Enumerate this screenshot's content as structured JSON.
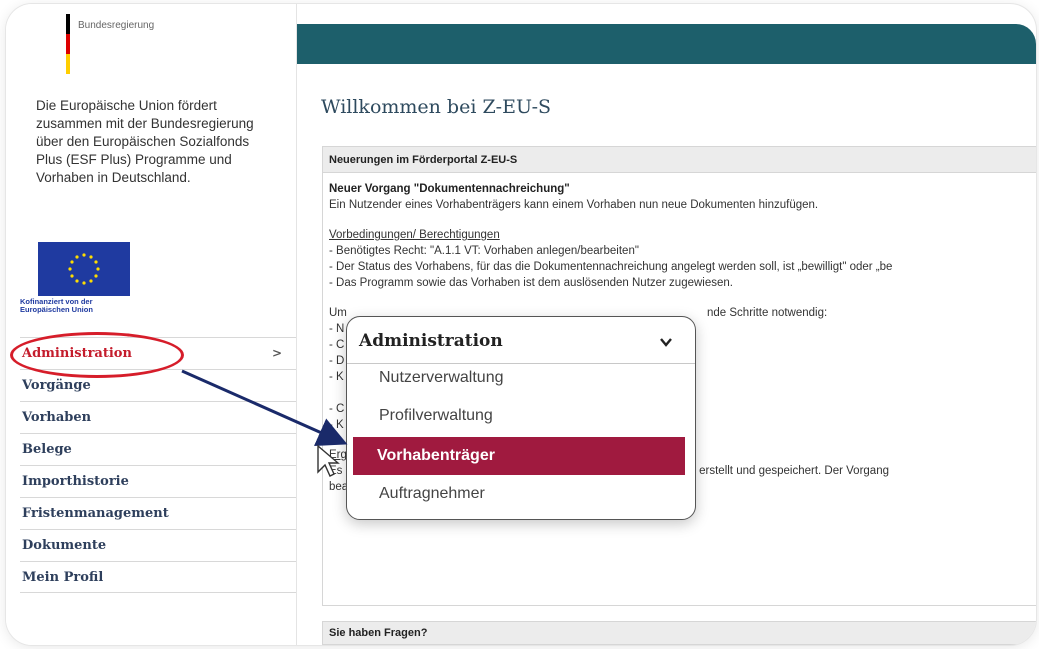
{
  "sidebar": {
    "brand": "Bundesregierung",
    "intro": "Die Europäische Union fördert zusammen mit der Bundesregierung über den Europäischen Sozialfonds Plus (ESF Plus) Programme und Vorhaben in Deutschland.",
    "eu_caption": "Kofinanziert von der Europäischen Union",
    "items": [
      {
        "label": "Administration"
      },
      {
        "label": "Vorgänge"
      },
      {
        "label": "Vorhaben"
      },
      {
        "label": "Belege"
      },
      {
        "label": "Importhistorie"
      },
      {
        "label": "Fristenmanagement"
      },
      {
        "label": "Dokumente"
      },
      {
        "label": "Mein Profil"
      }
    ],
    "active_chevron": ">"
  },
  "main": {
    "title": "Willkommen bei Z-EU-S",
    "news_header": "Neuerungen im Förderportal Z-EU-S",
    "news_title": "Neuer Vorgang \"Dokumentennachreichung\"",
    "news_text": "Ein Nutzender eines Vorhabenträgers kann einem Vorhaben nun neue Dokumenten hinzufügen.",
    "prereq_heading": "Vorbedingungen/ Berechtigungen",
    "prereq_lines": [
      "- Benötigtes Recht: \"A.1.1 VT: Vorhaben anlegen/bearbeiten\"",
      "- Der Status des Vorhabens, für das die Dokumentennachreichung angelegt werden soll, ist „bewilligt\" oder „be",
      "- Das Programm sowie das Vorhaben ist dem auslösenden Nutzer zugewiesen."
    ],
    "steps_intro_prefix": "Um",
    "steps_intro_suffix": "nde Schritte notwendig:",
    "hidden_line_prefixes": [
      "- N",
      "- C",
      "- D",
      "- K",
      "",
      "- C",
      "- K"
    ],
    "result_heading": "Ergebnis",
    "result_line1": "Es erscheint eine Erfolgsmeldung. Die Dokumentennachreichung wurde erstellt und gespeichert. Der Vorgang",
    "result_line2": "bearbeitet werden.",
    "questions_header": "Sie haben Fragen?"
  },
  "dropdown": {
    "header": "Administration",
    "options": [
      "Nutzerverwaltung",
      "Profilverwaltung",
      "Vorhabenträger",
      "Auftragnehmer"
    ],
    "selected": "Vorhabenträger"
  },
  "colors": {
    "topbar": "#1d5f6b",
    "highlight": "#a01a3f",
    "annotation_red": "#d61d2a",
    "annotation_arrow": "#1a2a6a",
    "nav_text": "#2e3f5c"
  },
  "icons": {
    "dropdown_chevron": "chevron-down-icon",
    "nav_chevron": "chevron-right-icon",
    "cursor": "mouse-cursor-icon"
  }
}
